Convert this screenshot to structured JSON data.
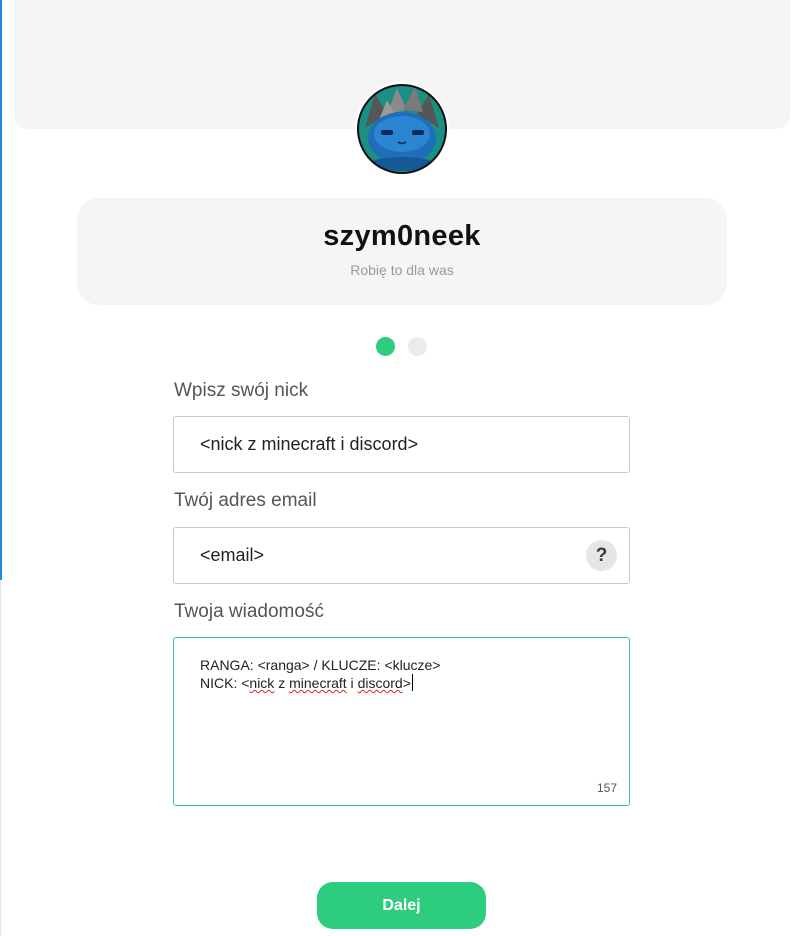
{
  "profile": {
    "name": "szym0neek",
    "tagline": "Robię to dla was"
  },
  "steps": {
    "current": 1,
    "total": 2
  },
  "form": {
    "nick_label": "Wpisz swój nick",
    "nick_value": "<nick z minecraft i discord>",
    "email_label": "Twój adres email",
    "email_value": "<email>",
    "email_help_icon": "?",
    "message_label": "Twoja wiadomość",
    "message_line1": "RANGA: <ranga> / KLUCZE: <klucze>",
    "message_line2": {
      "prefix": "NICK: <",
      "word1": "nick",
      "sep1": " z ",
      "word2": "minecraft",
      "sep2": " i ",
      "word3": "discord",
      "suffix": ">"
    },
    "char_count": "157"
  },
  "actions": {
    "next_label": "Dalej"
  },
  "colors": {
    "accent": "#2ecc7f",
    "card_bg": "#f5f5f5",
    "sidebar_edge": "#1a8fd6"
  }
}
